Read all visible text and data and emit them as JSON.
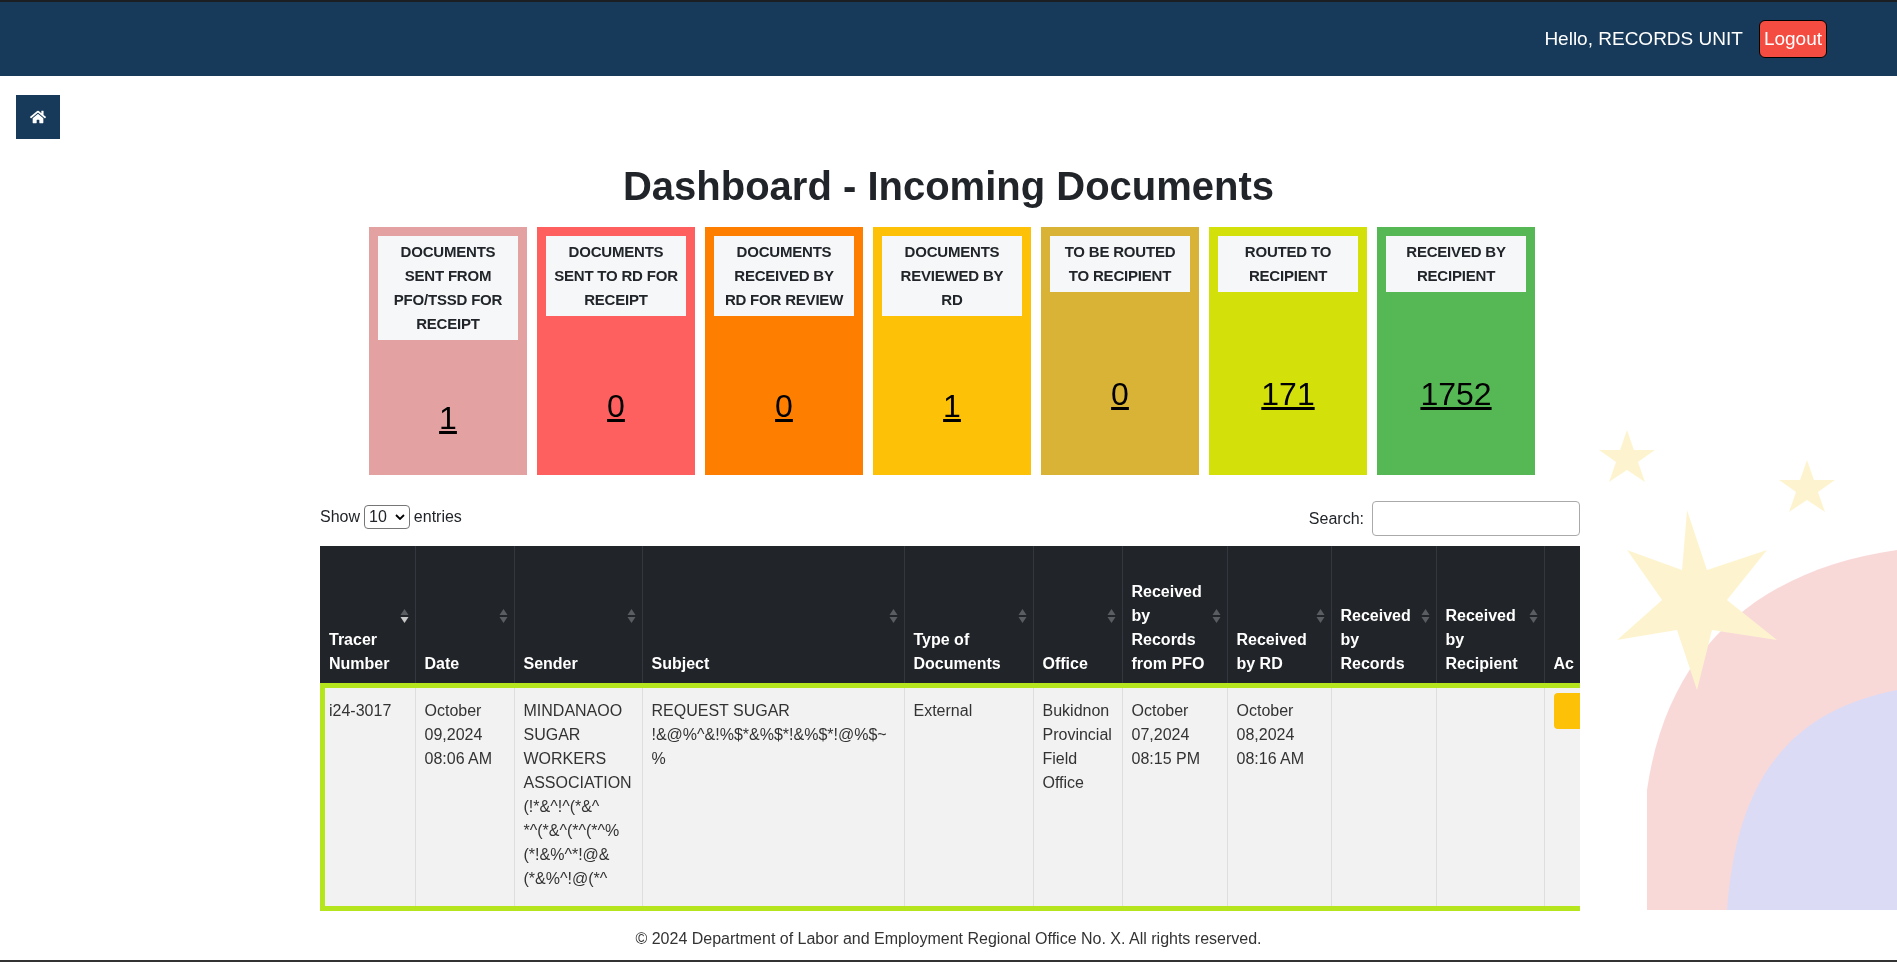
{
  "header": {
    "greeting": "Hello, RECORDS UNIT",
    "logout": "Logout"
  },
  "title": "Dashboard - Incoming Documents",
  "cards": [
    {
      "label": "DOCUMENTS SENT FROM PFO/TSSD FOR RECEIPT",
      "count": "1",
      "color": "#e4a1a1"
    },
    {
      "label": "DOCUMENTS SENT TO RD FOR RECEIPT",
      "count": "0",
      "color": "#fe5f5f"
    },
    {
      "label": "DOCUMENTS RECEIVED BY RD FOR REVIEW",
      "count": "0",
      "color": "#fe7f00"
    },
    {
      "label": "DOCUMENTS REVIEWED BY RD",
      "count": "1",
      "color": "#fdc107"
    },
    {
      "label": "TO BE ROUTED TO RECIPIENT",
      "count": "0",
      "color": "#d8b335"
    },
    {
      "label": "ROUTED TO RECIPIENT",
      "count": "171",
      "color": "#d3e00a"
    },
    {
      "label": "RECEIVED BY RECIPIENT",
      "count": "1752",
      "color": "#56b855"
    }
  ],
  "table_controls": {
    "show_label": "Show",
    "page_size": "10",
    "entries_label": "entries",
    "search_label": "Search:"
  },
  "table": {
    "columns": [
      {
        "label": "Tracer Number",
        "sorted": true
      },
      {
        "label": "Date",
        "sorted": false
      },
      {
        "label": "Sender",
        "sorted": false
      },
      {
        "label": "Subject",
        "sorted": false
      },
      {
        "label": "Type of Documents",
        "sorted": false
      },
      {
        "label": "Office",
        "sorted": false
      },
      {
        "label": "Received by Records from PFO",
        "sorted": false
      },
      {
        "label": "Received by RD",
        "sorted": false
      },
      {
        "label": "Received by Records",
        "sorted": false
      },
      {
        "label": "Received by Recipient",
        "sorted": false
      },
      {
        "label": "Ac"
      }
    ],
    "rows": [
      {
        "selected": true,
        "cells": [
          "i24-3017",
          "October 09,2024 08:06 AM",
          "MINDANAOO SUGAR WORKERS ASSOCIATION (!*&^!^(*&^ *^(*&^(*^(*^% (*!&%^*!@& (*&%^!@(*^",
          "REQUEST SUGAR !&@%^&!%$*&%$*!&%$*!@%$~%",
          "External",
          "Bukidnon Provincial Field Office",
          "October 07,2024 08:15 PM",
          "October 08,2024 08:16 AM",
          "",
          "",
          ""
        ]
      }
    ]
  },
  "footer": "© 2024 Department of Labor and Employment Regional Office No. X. All rights reserved."
}
